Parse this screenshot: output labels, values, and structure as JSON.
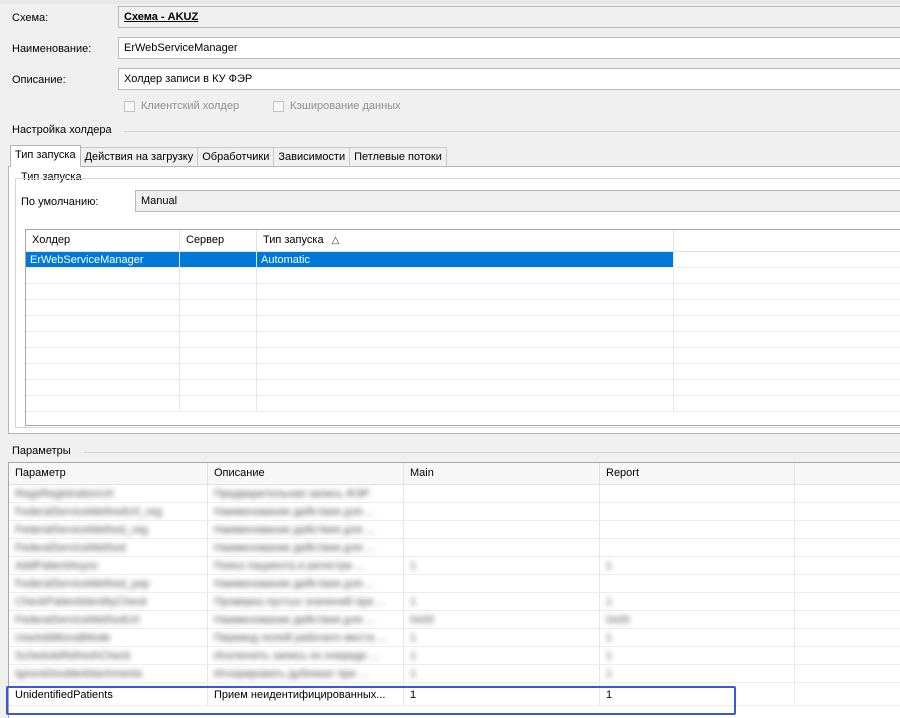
{
  "header": {
    "schema_label": "Схема:",
    "schema_value": "Схема - AKUZ",
    "name_label": "Наименование:",
    "name_value": "ErWebServiceManager",
    "desc_label": "Описание:",
    "desc_value": "Холдер записи в КУ ФЭР",
    "client_holder": "Клиентский холдер",
    "data_caching": "Кэширование данных"
  },
  "holder_settings": {
    "title": "Настройка холдера",
    "tabs": [
      "Тип запуска",
      "Действия на загрузку",
      "Обработчики",
      "Зависимости",
      "Петлевые потоки"
    ],
    "launch_group_title": "Тип запуска",
    "default_label": "По умолчанию:",
    "default_value": "Manual",
    "grid": {
      "columns": [
        "Холдер",
        "Сервер",
        "Тип запуска"
      ],
      "sort_icon": "triangle-up",
      "rows": [
        {
          "holder": "ErWebServiceManager",
          "server": "",
          "launch_type": "Automatic"
        }
      ]
    }
  },
  "parameters": {
    "title": "Параметры",
    "columns": [
      "Параметр",
      "Описание",
      "Main",
      "Report"
    ],
    "blurred_rows": [
      {
        "param": "RegsRegistrationUrl",
        "desc": "Предварительная запись ФЭР",
        "main": "",
        "report": ""
      },
      {
        "param": "FederalServiceMethodUrl_reg",
        "desc": "Наименование действия для ...",
        "main": "",
        "report": ""
      },
      {
        "param": "FederalServiceMethod_reg",
        "desc": "Наименование действия для ...",
        "main": "",
        "report": ""
      },
      {
        "param": "FederalServiceMethod",
        "desc": "Наименование действия для ...",
        "main": "",
        "report": ""
      },
      {
        "param": "AddPatientAsync",
        "desc": "Поиск пациента в регистре ...",
        "main": "1",
        "report": "1"
      },
      {
        "param": "FederalServiceMethod_pay",
        "desc": "Наименование действия для ...",
        "main": "",
        "report": ""
      },
      {
        "param": "CheckPatientIdentityCheck",
        "desc": "Проверка пустых значений при ...",
        "main": "1",
        "report": "1"
      },
      {
        "param": "FederalServiceMethodUrl",
        "desc": "Наименование действия для ...",
        "main": "0x00",
        "report": "0x00"
      },
      {
        "param": "UseAdditionalMode",
        "desc": "Перевод полей рабочего места ...",
        "main": "1",
        "report": "1"
      },
      {
        "param": "ScheduleRefreshCheck",
        "desc": "Исключить запись из очереди ...",
        "main": "1",
        "report": "1"
      },
      {
        "param": "IgnoreDoubleAttachments",
        "desc": "Игнорировать дубликат при ...",
        "main": "1",
        "report": "1"
      }
    ],
    "highlighted_row": {
      "param": "UnidentifiedPatients",
      "desc": "Прием неидентифицированных...",
      "main": "1",
      "report": "1"
    }
  },
  "colors": {
    "selection": "#0078d7",
    "highlight_border": "#3a57d6",
    "window_bg": "#f0f0f0"
  }
}
